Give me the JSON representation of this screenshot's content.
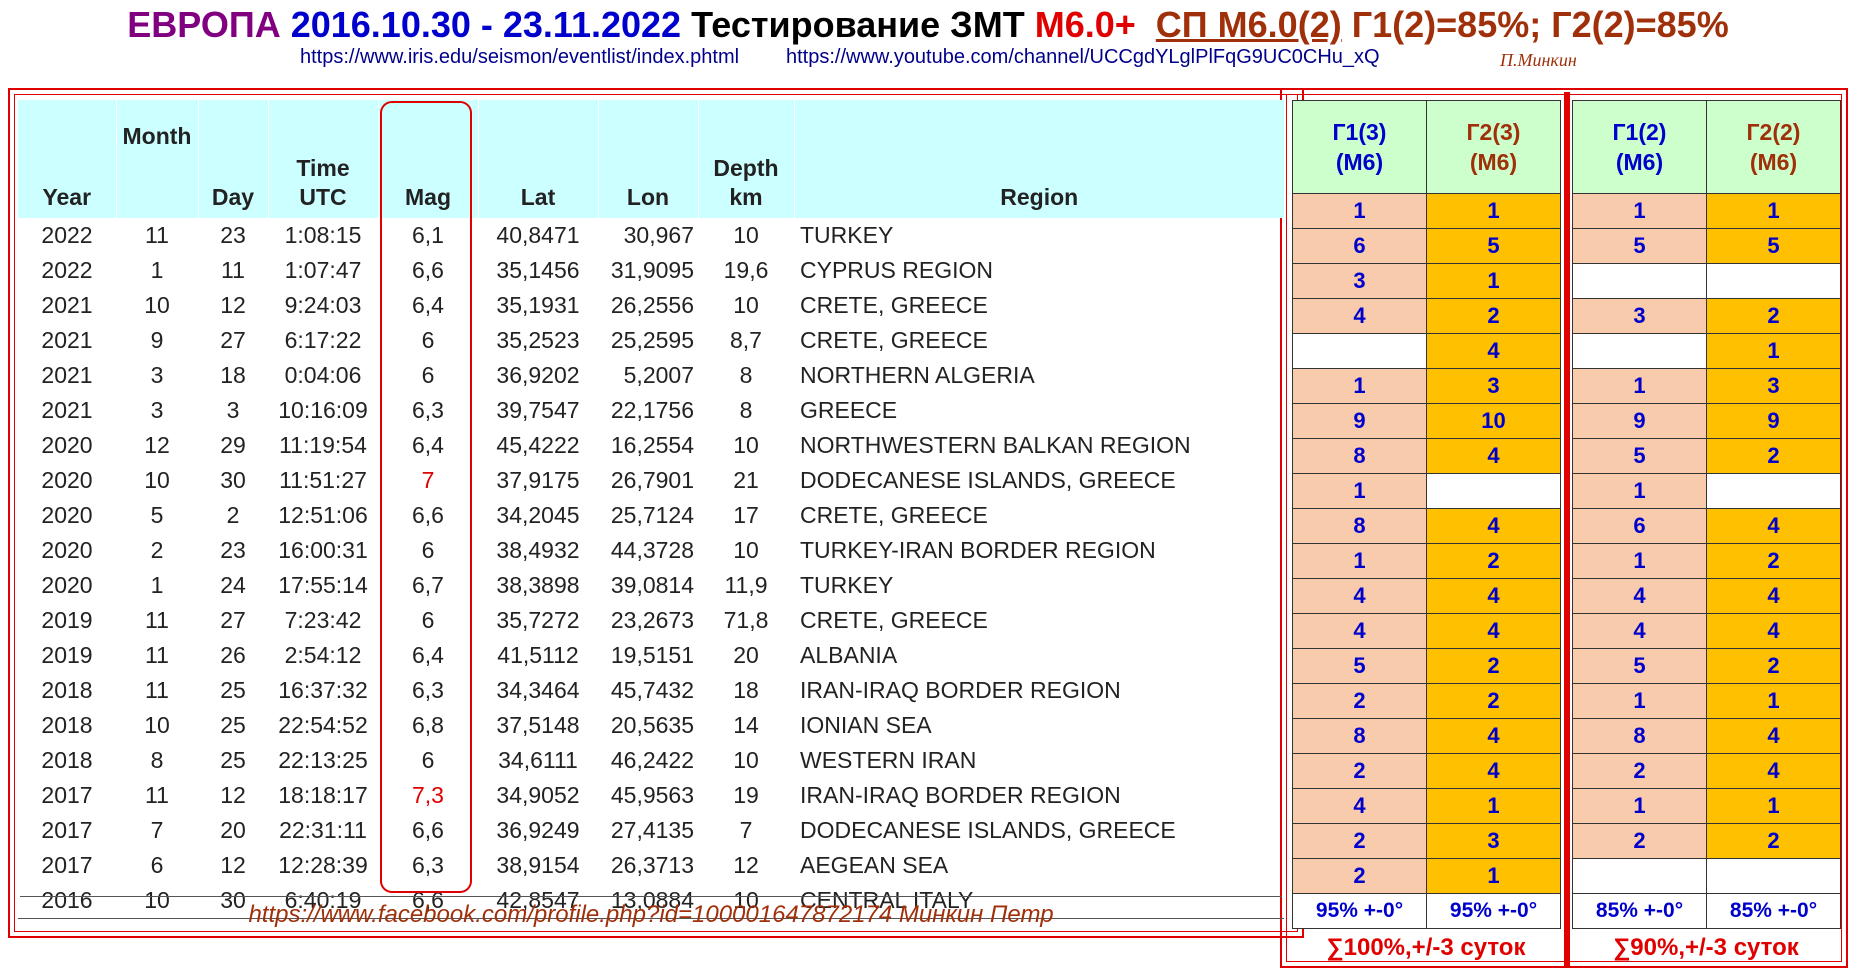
{
  "title": {
    "europe": "ЕВРОПА",
    "dates": "2016.10.30 - 23.11.2022",
    "test": "Тестирование ЗМТ",
    "m6": "М6.0+",
    "sp": "СП М6.0(2)",
    "g": "Г1(2)=85%; Г2(2)=85%"
  },
  "links": {
    "iris": "https://www.iris.edu/seismon/eventlist/index.phtml",
    "youtube": "https://www.youtube.com/channel/UCCgdYLglPlFqG9UC0CHu_xQ",
    "author": "П.Минкин"
  },
  "columns": {
    "year": "Year",
    "month": "Month",
    "day": "Day",
    "time": "Time UTC",
    "mag": "Mag",
    "lat": "Lat",
    "lon": "Lon",
    "depth": "Depth km",
    "region": "Region"
  },
  "rows": [
    {
      "year": "2022",
      "month": "11",
      "day": "23",
      "time": "1:08:15",
      "mag": "6,1",
      "lat": "40,8471",
      "lon": "30,967",
      "depth": "10",
      "region": "TURKEY"
    },
    {
      "year": "2022",
      "month": "1",
      "day": "11",
      "time": "1:07:47",
      "mag": "6,6",
      "lat": "35,1456",
      "lon": "31,9095",
      "depth": "19,6",
      "region": "CYPRUS REGION"
    },
    {
      "year": "2021",
      "month": "10",
      "day": "12",
      "time": "9:24:03",
      "mag": "6,4",
      "lat": "35,1931",
      "lon": "26,2556",
      "depth": "10",
      "region": "CRETE, GREECE"
    },
    {
      "year": "2021",
      "month": "9",
      "day": "27",
      "time": "6:17:22",
      "mag": "6",
      "lat": "35,2523",
      "lon": "25,2595",
      "depth": "8,7",
      "region": "CRETE, GREECE"
    },
    {
      "year": "2021",
      "month": "3",
      "day": "18",
      "time": "0:04:06",
      "mag": "6",
      "lat": "36,9202",
      "lon": "5,2007",
      "depth": "8",
      "region": "NORTHERN ALGERIA"
    },
    {
      "year": "2021",
      "month": "3",
      "day": "3",
      "time": "10:16:09",
      "mag": "6,3",
      "lat": "39,7547",
      "lon": "22,1756",
      "depth": "8",
      "region": "GREECE"
    },
    {
      "year": "2020",
      "month": "12",
      "day": "29",
      "time": "11:19:54",
      "mag": "6,4",
      "lat": "45,4222",
      "lon": "16,2554",
      "depth": "10",
      "region": "NORTHWESTERN BALKAN REGION"
    },
    {
      "year": "2020",
      "month": "10",
      "day": "30",
      "time": "11:51:27",
      "mag": "7",
      "lat": "37,9175",
      "lon": "26,7901",
      "depth": "21",
      "region": "DODECANESE ISLANDS, GREECE",
      "red": true
    },
    {
      "year": "2020",
      "month": "5",
      "day": "2",
      "time": "12:51:06",
      "mag": "6,6",
      "lat": "34,2045",
      "lon": "25,7124",
      "depth": "17",
      "region": "CRETE, GREECE"
    },
    {
      "year": "2020",
      "month": "2",
      "day": "23",
      "time": "16:00:31",
      "mag": "6",
      "lat": "38,4932",
      "lon": "44,3728",
      "depth": "10",
      "region": "TURKEY-IRAN BORDER REGION"
    },
    {
      "year": "2020",
      "month": "1",
      "day": "24",
      "time": "17:55:14",
      "mag": "6,7",
      "lat": "38,3898",
      "lon": "39,0814",
      "depth": "11,9",
      "region": "TURKEY"
    },
    {
      "year": "2019",
      "month": "11",
      "day": "27",
      "time": "7:23:42",
      "mag": "6",
      "lat": "35,7272",
      "lon": "23,2673",
      "depth": "71,8",
      "region": "CRETE, GREECE"
    },
    {
      "year": "2019",
      "month": "11",
      "day": "26",
      "time": "2:54:12",
      "mag": "6,4",
      "lat": "41,5112",
      "lon": "19,5151",
      "depth": "20",
      "region": "ALBANIA"
    },
    {
      "year": "2018",
      "month": "11",
      "day": "25",
      "time": "16:37:32",
      "mag": "6,3",
      "lat": "34,3464",
      "lon": "45,7432",
      "depth": "18",
      "region": "IRAN-IRAQ BORDER REGION"
    },
    {
      "year": "2018",
      "month": "10",
      "day": "25",
      "time": "22:54:52",
      "mag": "6,8",
      "lat": "37,5148",
      "lon": "20,5635",
      "depth": "14",
      "region": "IONIAN SEA"
    },
    {
      "year": "2018",
      "month": "8",
      "day": "25",
      "time": "22:13:25",
      "mag": "6",
      "lat": "34,6111",
      "lon": "46,2422",
      "depth": "10",
      "region": "WESTERN IRAN"
    },
    {
      "year": "2017",
      "month": "11",
      "day": "12",
      "time": "18:18:17",
      "mag": "7,3",
      "lat": "34,9052",
      "lon": "45,9563",
      "depth": "19",
      "region": "IRAN-IRAQ BORDER REGION",
      "red": true
    },
    {
      "year": "2017",
      "month": "7",
      "day": "20",
      "time": "22:31:11",
      "mag": "6,6",
      "lat": "36,9249",
      "lon": "27,4135",
      "depth": "7",
      "region": "DODECANESE ISLANDS, GREECE"
    },
    {
      "year": "2017",
      "month": "6",
      "day": "12",
      "time": "12:28:39",
      "mag": "6,3",
      "lat": "38,9154",
      "lon": "26,3713",
      "depth": "12",
      "region": "AEGEAN SEA"
    },
    {
      "year": "2016",
      "month": "10",
      "day": "30",
      "time": "6:40:19",
      "mag": "6,6",
      "lat": "42,8547",
      "lon": "13,0884",
      "depth": "10",
      "region": "CENTRAL ITALY"
    }
  ],
  "footer_url": "https://www.facebook.com/profile.php?id=100001647872174  Минкин Петр",
  "g3": {
    "headers": [
      "Г1(3) (М6)",
      "Г2(3) (М6)"
    ],
    "g1": [
      "1",
      "6",
      "3",
      "4",
      "",
      "1",
      "9",
      "8",
      "1",
      "8",
      "1",
      "4",
      "4",
      "5",
      "2",
      "8",
      "2",
      "4",
      "2",
      "2"
    ],
    "g2": [
      "1",
      "5",
      "1",
      "2",
      "4",
      "3",
      "10",
      "4",
      "",
      "4",
      "2",
      "4",
      "4",
      "2",
      "2",
      "4",
      "4",
      "1",
      "3",
      "1"
    ],
    "footer": [
      "95% +-0°",
      "95% +-0°"
    ],
    "sum": "∑100%,+/-3 суток"
  },
  "g2t": {
    "headers": [
      "Г1(2) (М6)",
      "Г2(2) (М6)"
    ],
    "g1": [
      "1",
      "5",
      "",
      "3",
      "",
      "1",
      "9",
      "5",
      "1",
      "6",
      "1",
      "4",
      "4",
      "5",
      "1",
      "8",
      "2",
      "1",
      "2",
      ""
    ],
    "g2": [
      "1",
      "5",
      "",
      "2",
      "1",
      "3",
      "9",
      "2",
      "",
      "4",
      "2",
      "4",
      "4",
      "2",
      "1",
      "4",
      "4",
      "1",
      "2",
      ""
    ],
    "footer": [
      "85% +-0°",
      "85% +-0°"
    ],
    "sum": "∑90%,+/-3 суток"
  },
  "colors": {
    "red": "#e00000",
    "blue": "#0000cc",
    "salmon": "#f8cbad",
    "gold": "#ffc000",
    "cyan": "#ccffff",
    "green": "#ccffcc"
  }
}
